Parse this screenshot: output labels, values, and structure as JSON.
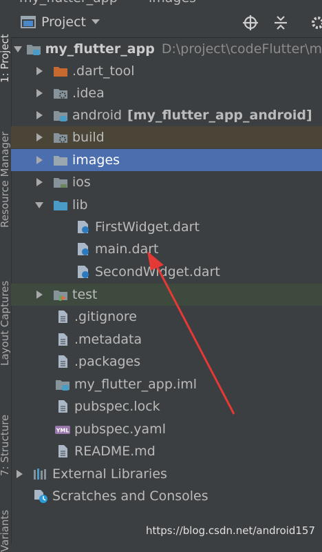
{
  "breadcrumb": {
    "app": "my_flutter_app",
    "folder": "images"
  },
  "toolstrip": {
    "project": "1: Project",
    "resource_manager": "Resource Manager",
    "layout_captures": "Layout Captures",
    "structure": "7: Structure",
    "variants": "Variants"
  },
  "header": {
    "title": "Project"
  },
  "tree": {
    "root_name": "my_flutter_app",
    "root_path": "D:\\project\\codeFlutter\\m",
    "dart_tool": ".dart_tool",
    "idea": ".idea",
    "android": "android",
    "android_module": "[my_flutter_app_android]",
    "build": "build",
    "images": "images",
    "ios": "ios",
    "lib": "lib",
    "first_widget": "FirstWidget.dart",
    "main": "main.dart",
    "second_widget": "SecondWidget.dart",
    "test": "test",
    "gitignore": ".gitignore",
    "metadata": ".metadata",
    "packages": ".packages",
    "iml": "my_flutter_app.iml",
    "pubspec_lock": "pubspec.lock",
    "pubspec_yaml": "pubspec.yaml",
    "readme": "README.md",
    "external_libraries": "External Libraries",
    "scratches": "Scratches and Consoles"
  },
  "watermark": "https://blog.csdn.net/android157",
  "colors": {
    "selection": "#4b6eaf",
    "excluded_row": "#4a4537",
    "test_row": "#3e4a3e",
    "annotation_arrow": "#e53935",
    "folder": "#87939a",
    "excluded_folder": "#c86a2f",
    "source_folder": "#4a9cc7"
  }
}
